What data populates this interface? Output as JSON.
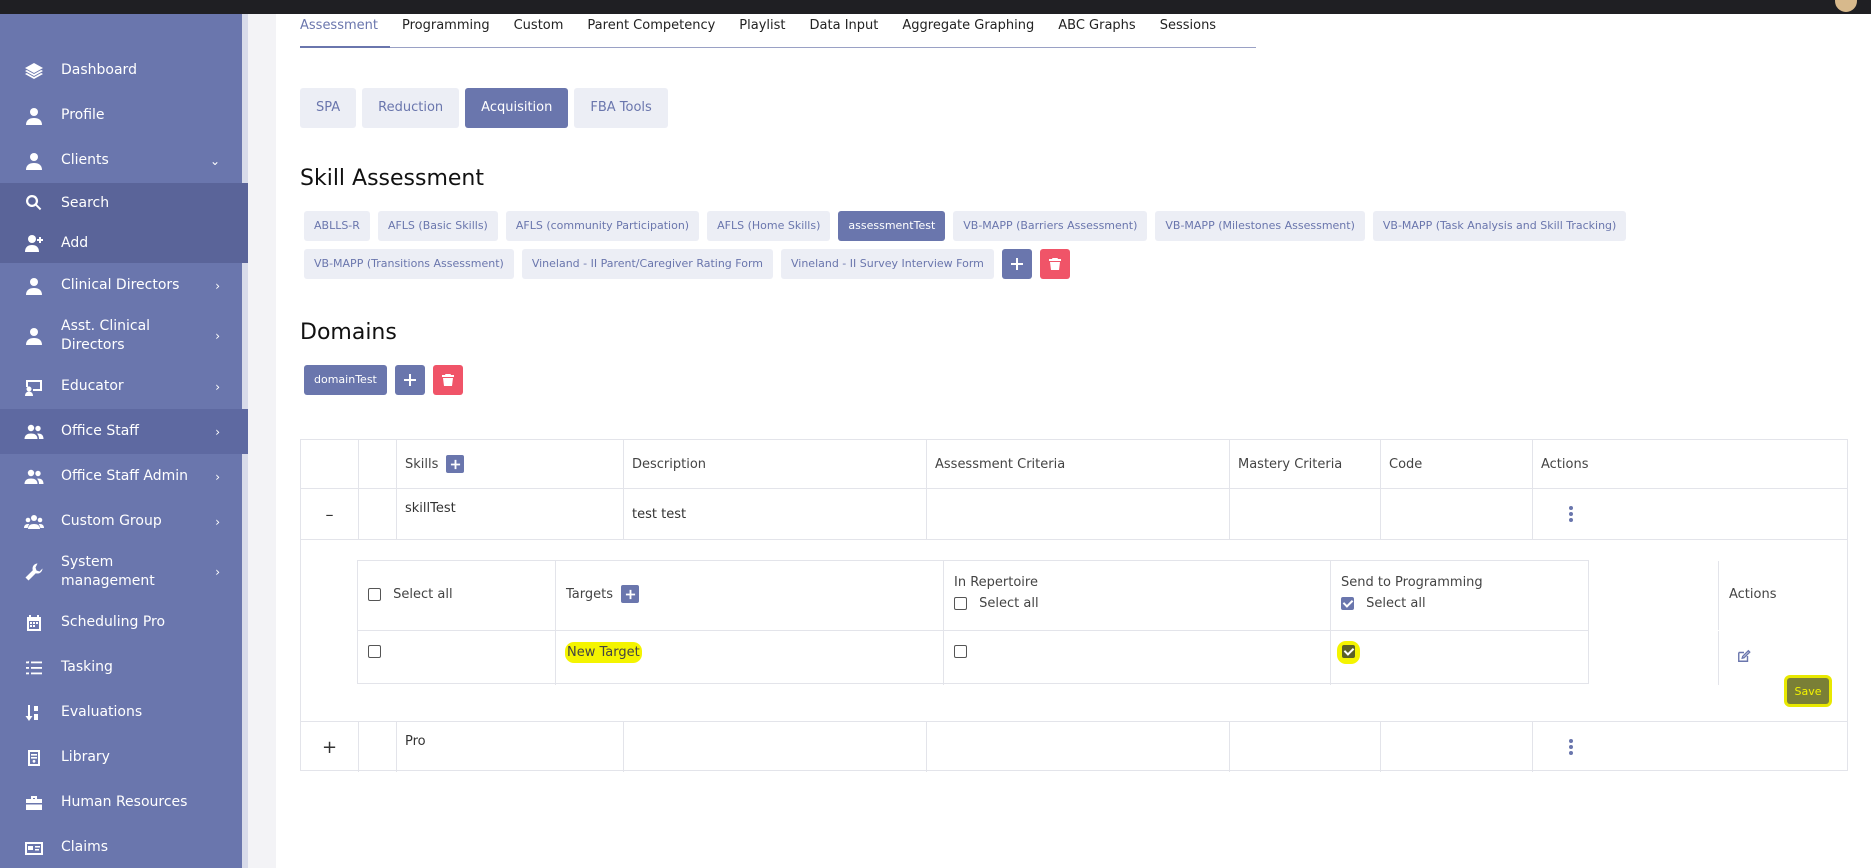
{
  "sidebar": {
    "items": [
      {
        "label": "Dashboard",
        "icon": "layers-icon"
      },
      {
        "label": "Profile",
        "icon": "user-icon"
      },
      {
        "label": "Clients",
        "icon": "user-icon",
        "expanded": true
      },
      {
        "label": "Search",
        "icon": "search-icon",
        "sub": true
      },
      {
        "label": "Add",
        "icon": "user-plus-icon",
        "sub": true
      },
      {
        "label": "Clinical Directors",
        "icon": "user-icon"
      },
      {
        "label": "Asst. Clinical Directors",
        "icon": "user-icon"
      },
      {
        "label": "Educator",
        "icon": "chalkboard-icon"
      },
      {
        "label": "Office Staff",
        "icon": "users-icon"
      },
      {
        "label": "Office Staff Admin",
        "icon": "users-icon"
      },
      {
        "label": "Custom Group",
        "icon": "group-icon"
      },
      {
        "label": "System management",
        "icon": "wrench-icon"
      },
      {
        "label": "Scheduling Pro",
        "icon": "calendar-icon"
      },
      {
        "label": "Tasking",
        "icon": "list-icon"
      },
      {
        "label": "Evaluations",
        "icon": "sort-icon"
      },
      {
        "label": "Library",
        "icon": "library-icon"
      },
      {
        "label": "Human Resources",
        "icon": "briefcase-icon"
      },
      {
        "label": "Claims",
        "icon": "id-card-icon"
      }
    ]
  },
  "tabs": [
    "Assessment",
    "Programming",
    "Custom",
    "Parent Competency",
    "Playlist",
    "Data Input",
    "Aggregate Graphing",
    "ABC Graphs",
    "Sessions"
  ],
  "segments": [
    "SPA",
    "Reduction",
    "Acquisition",
    "FBA Tools"
  ],
  "skill_assessment": {
    "title": "Skill Assessment",
    "chips": [
      "ABLLS-R",
      "AFLS (Basic Skills)",
      "AFLS (community Participation)",
      "AFLS (Home Skills)",
      "assessmentTest",
      "VB-MAPP (Barriers Assessment)",
      "VB-MAPP (Milestones Assessment)",
      "VB-MAPP (Task Analysis and Skill Tracking)",
      "VB-MAPP (Transitions Assessment)",
      "Vineland - II Parent/Caregiver Rating Form",
      "Vineland - II Survey Interview Form"
    ],
    "active": "assessmentTest"
  },
  "domains": {
    "title": "Domains",
    "chips": [
      "domainTest"
    ]
  },
  "table": {
    "headers": {
      "skills": "Skills",
      "description": "Description",
      "assessment": "Assessment Criteria",
      "mastery": "Mastery Criteria",
      "code": "Code",
      "actions": "Actions"
    },
    "rows": [
      {
        "toggle": "–",
        "skill": "skillTest",
        "description": "test test"
      },
      {
        "toggle": "+",
        "skill": "Pro",
        "description": ""
      }
    ],
    "targets": {
      "select_all": "Select all",
      "targets_header": "Targets",
      "in_repertoire": "In Repertoire",
      "send_to_programming": "Send to Programming",
      "actions": "Actions",
      "row": {
        "name": "New Target",
        "selected": false,
        "in_repertoire": false,
        "send_to_programming": true
      },
      "save": "Save"
    }
  },
  "colors": {
    "accent": "#6a76ad",
    "danger": "#f05468",
    "highlight": "#f4f400"
  }
}
